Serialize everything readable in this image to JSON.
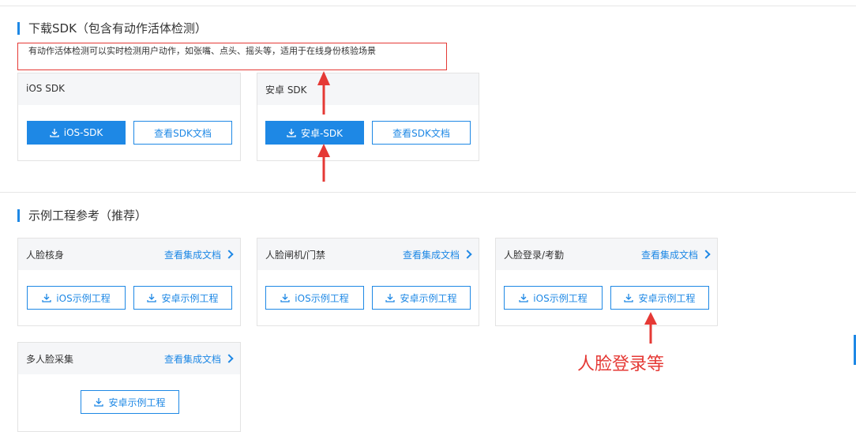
{
  "section1": {
    "title": "下载SDK（包含有动作活体检测）",
    "description": "有动作活体检测可以实时检测用户动作，如张嘴、点头、摇头等，适用于在线身份核验场景"
  },
  "sdk_cards": [
    {
      "title": "iOS SDK",
      "primary_label": "iOS-SDK",
      "secondary_label": "查看SDK文档"
    },
    {
      "title": "安卓 SDK",
      "primary_label": "安卓-SDK",
      "secondary_label": "查看SDK文档"
    }
  ],
  "section2": {
    "title": "示例工程参考（推荐）"
  },
  "example_cards": [
    {
      "title": "人脸核身",
      "link_label": "查看集成文档",
      "ios_label": "iOS示例工程",
      "android_label": "安卓示例工程"
    },
    {
      "title": "人脸闸机/门禁",
      "link_label": "查看集成文档",
      "ios_label": "iOS示例工程",
      "android_label": "安卓示例工程"
    },
    {
      "title": "人脸登录/考勤",
      "link_label": "查看集成文档",
      "ios_label": "iOS示例工程",
      "android_label": "安卓示例工程"
    },
    {
      "title": "多人脸采集",
      "link_label": "查看集成文档",
      "android_label": "安卓示例工程"
    }
  ],
  "annotation": {
    "text": "人脸登录等",
    "color": "#e53935"
  },
  "colors": {
    "accent": "#1e88e5",
    "annotation_red": "#e53935"
  },
  "icons": {
    "download": "download-icon",
    "chevron": "chevron-right-icon",
    "arrow": "red-arrow-icon"
  }
}
